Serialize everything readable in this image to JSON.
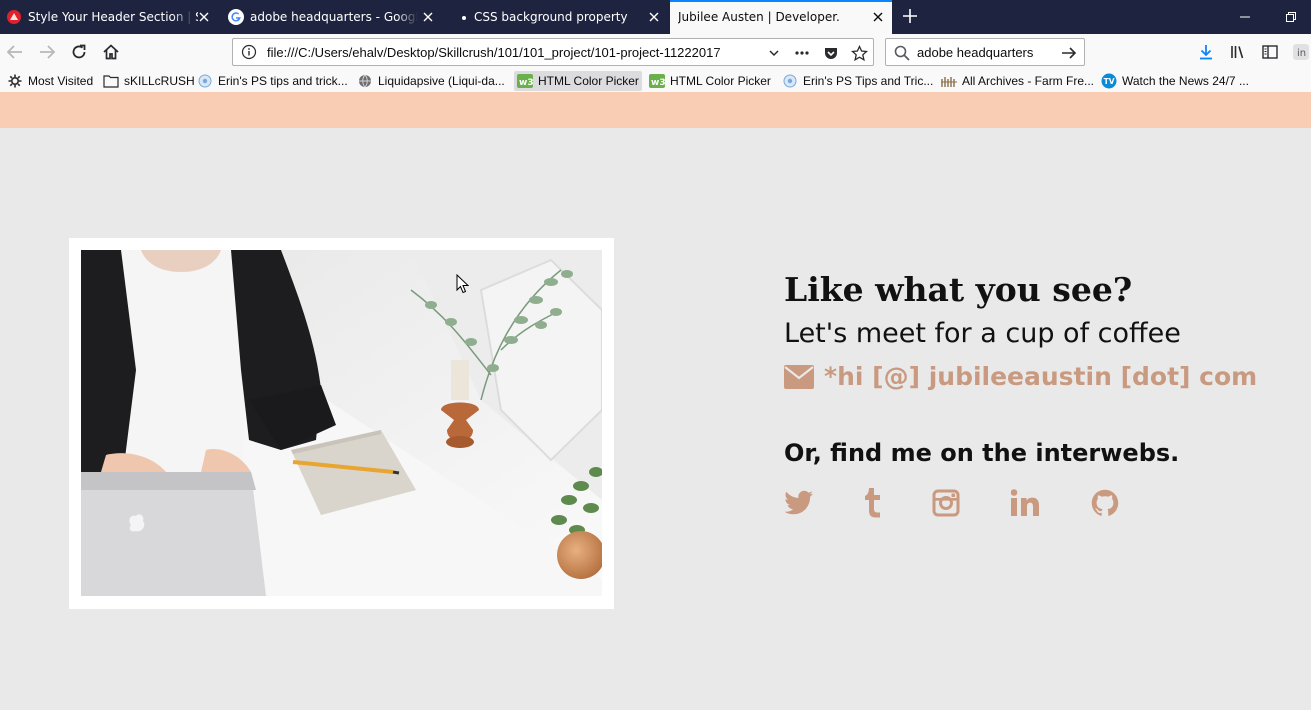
{
  "colors": {
    "tabbar_bg": "#1e2440",
    "toolbar_bg": "#f9f9fa",
    "page_bg": "#e9e9e9",
    "page_strip": "#f8cdb3",
    "accent": "#c99a7f",
    "heading": "#111111"
  },
  "tabs": [
    {
      "title": "Style Your Header Section | Skill",
      "icon": "skillcrush-icon",
      "active": false
    },
    {
      "title": "adobe headquarters - Google S",
      "icon": "google-icon",
      "active": false
    },
    {
      "title": "CSS background property",
      "icon": "loading-dot-icon",
      "active": false
    },
    {
      "title": "Jubilee Austen | Developer.",
      "icon": "none",
      "active": true
    }
  ],
  "nav": {
    "url": "file:///C:/Users/ehalv/Desktop/Skillcrush/101/101_project/101-project-11222017",
    "search_query": "adobe headquarters"
  },
  "bookmarks": [
    {
      "label": "Most Visited",
      "icon": "gear-icon"
    },
    {
      "label": "sKILLcRUSH",
      "icon": "folder-icon"
    },
    {
      "label": "Erin's PS tips and trick...",
      "icon": "circle-icon"
    },
    {
      "label": "Liquidapsive (Liqui-da...",
      "icon": "globe-icon"
    },
    {
      "label": "HTML Color Picker",
      "icon": "w3-icon"
    },
    {
      "label": "HTML Color Picker",
      "icon": "w3-icon"
    },
    {
      "label": "Erin's PS Tips and Tric...",
      "icon": "circle-icon"
    },
    {
      "label": "All Archives - Farm Fre...",
      "icon": "farm-icon"
    },
    {
      "label": "Watch the News 24/7 ...",
      "icon": "tv-icon"
    }
  ],
  "page": {
    "heading": "Like what you see?",
    "subheading": "Let's meet for a cup of coffee",
    "email": "*hi [@] jubileeaustin [dot] com",
    "social_heading": "Or, find me on the interwebs.",
    "social_links": [
      "twitter-icon",
      "tumblr-icon",
      "instagram-icon",
      "linkedin-icon",
      "github-icon"
    ]
  }
}
